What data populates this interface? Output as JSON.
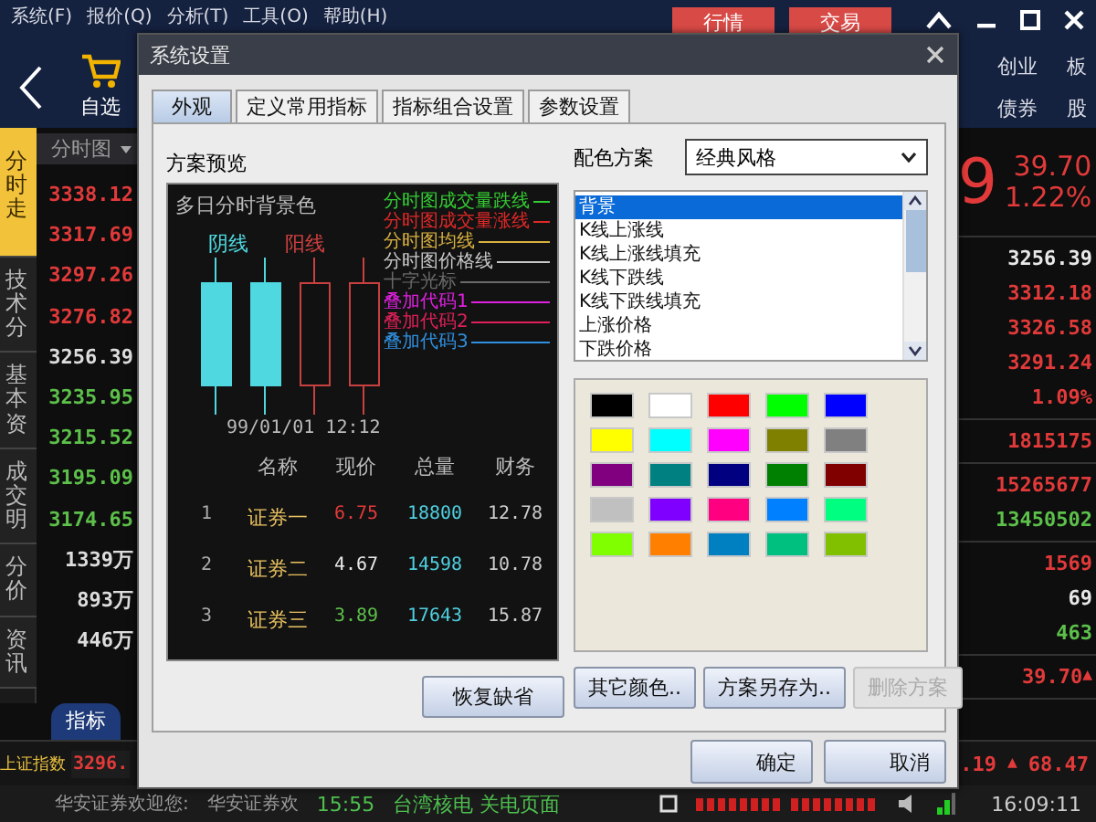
{
  "menu": [
    "系统(F)",
    "报价(Q)",
    "分析(T)",
    "工具(O)",
    "帮助(H)"
  ],
  "top_buttons": [
    "行情",
    "交易"
  ],
  "toolbar": {
    "favorites": "自选",
    "right_items": [
      {
        "top": "创业",
        "bottom": "债券"
      },
      {
        "top": "板",
        "bottom": "股"
      }
    ]
  },
  "side_tabs": [
    {
      "label": "分时走",
      "selected": true
    },
    {
      "label": "技术分",
      "selected": false
    },
    {
      "label": "基本资",
      "selected": false
    },
    {
      "label": "成交明",
      "selected": false
    },
    {
      "label": "分价",
      "selected": false
    },
    {
      "label": "资讯",
      "selected": false
    }
  ],
  "axis": {
    "header": "分时图",
    "values": [
      {
        "text": "3338.12",
        "kind": "up"
      },
      {
        "text": "3317.69",
        "kind": "up"
      },
      {
        "text": "3297.26",
        "kind": "up"
      },
      {
        "text": "3276.82",
        "kind": "up"
      },
      {
        "text": "3256.39",
        "kind": "flat"
      },
      {
        "text": "3235.95",
        "kind": "down"
      },
      {
        "text": "3215.52",
        "kind": "down"
      },
      {
        "text": "3195.09",
        "kind": "down"
      },
      {
        "text": "3174.65",
        "kind": "down"
      },
      {
        "text": "1339万",
        "kind": "flat"
      },
      {
        "text": "893万",
        "kind": "flat"
      },
      {
        "text": "446万",
        "kind": "flat"
      }
    ]
  },
  "right_panel": {
    "big_price": "9",
    "change": "39.70",
    "change_pct": "1.22%",
    "groups": [
      [
        {
          "text": "3256.39",
          "kind": "flat"
        },
        {
          "text": "3312.18",
          "kind": "up"
        },
        {
          "text": "3326.58",
          "kind": "up"
        },
        {
          "text": "3291.24",
          "kind": "up"
        },
        {
          "text": "1.09%",
          "kind": "up"
        }
      ],
      [
        {
          "text": "1815175",
          "kind": "up"
        }
      ],
      [
        {
          "text": "15265677",
          "kind": "up"
        },
        {
          "text": "13450502",
          "kind": "down"
        }
      ],
      [
        {
          "text": "1569",
          "kind": "up"
        },
        {
          "text": "69",
          "kind": "flat"
        },
        {
          "text": "463",
          "kind": "down"
        }
      ],
      [
        {
          "text": "39.70",
          "kind": "up",
          "arrow": "▲"
        }
      ]
    ]
  },
  "bottom_tabs": [
    {
      "label": "指标",
      "selected": true
    }
  ],
  "index_row": {
    "name": "上证指数",
    "value": "3296.",
    "change": ".19",
    "arrow": "▲",
    "amount": "68.47"
  },
  "status_bar": {
    "texts": [
      {
        "text": "华安证券欢迎您:",
        "kind": "info"
      },
      {
        "text": "华安证券欢",
        "kind": "info"
      },
      {
        "text": "15:55",
        "kind": "news"
      },
      {
        "text": "台湾核电 关电页面",
        "kind": "news"
      }
    ],
    "clock": "16:09:11"
  },
  "dialog": {
    "title": "系统设置",
    "tabs": [
      {
        "label": "外观",
        "selected": true
      },
      {
        "label": "定义常用指标",
        "selected": false
      },
      {
        "label": "指标组合设置",
        "selected": false
      },
      {
        "label": "参数设置",
        "selected": false
      }
    ],
    "preview": {
      "label": "方案预览",
      "background_label": "多日分时背景色",
      "legend": [
        {
          "label": "分时图成交量跌线",
          "color": "#33cc33"
        },
        {
          "label": "分时图成交量涨线",
          "color": "#e02828"
        },
        {
          "label": "分时图均线",
          "color": "#d8b040"
        },
        {
          "label": "分时图价格线",
          "color": "#c8c8c8"
        },
        {
          "label": "十字光标",
          "color": "#6a6a6a"
        },
        {
          "label": "叠加代码1",
          "color": "#e020e0"
        },
        {
          "label": "叠加代码2",
          "color": "#e0205a"
        },
        {
          "label": "叠加代码3",
          "color": "#3090e0"
        }
      ],
      "down_label": "阴线",
      "up_label": "阳线",
      "timestamp": "99/01/01 12:12",
      "columns": [
        "名称",
        "现价",
        "总量",
        "财务"
      ],
      "rows": [
        {
          "index": "1",
          "name": "证券一",
          "price": "6.75",
          "kind": "up",
          "volume": "18800",
          "finance": "12.78"
        },
        {
          "index": "2",
          "name": "证券二",
          "price": "4.67",
          "kind": "flat",
          "volume": "14598",
          "finance": "10.78"
        },
        {
          "index": "3",
          "name": "证券三",
          "price": "3.89",
          "kind": "down",
          "volume": "17643",
          "finance": "15.87"
        }
      ]
    },
    "restore_button": "恢复缺省",
    "scheme_label": "配色方案",
    "scheme_value": "经典风格",
    "elements": [
      {
        "label": "背景",
        "selected": true
      },
      {
        "label": "K线上涨线",
        "selected": false
      },
      {
        "label": "K线上涨线填充",
        "selected": false
      },
      {
        "label": "K线下跌线",
        "selected": false
      },
      {
        "label": "K线下跌线填充",
        "selected": false
      },
      {
        "label": "上涨价格",
        "selected": false
      },
      {
        "label": "下跌价格",
        "selected": false
      }
    ],
    "swatches": [
      {
        "color": "#000000"
      },
      {
        "color": "#ffffff"
      },
      {
        "color": "#ff0000"
      },
      {
        "color": "#00ff00"
      },
      {
        "color": "#0000ff"
      },
      {
        "color": "#ffff00"
      },
      {
        "color": "#00ffff"
      },
      {
        "color": "#ff00ff"
      },
      {
        "color": "#808000"
      },
      {
        "color": "#808080"
      },
      {
        "color": "#800080"
      },
      {
        "color": "#008080"
      },
      {
        "color": "#000080"
      },
      {
        "color": "#008000"
      },
      {
        "color": "#800000"
      },
      {
        "color": "#c0c0c0"
      },
      {
        "color": "#8000ff"
      },
      {
        "color": "#ff0080"
      },
      {
        "color": "#0080ff"
      },
      {
        "color": "#00ff80"
      },
      {
        "color": "#80ff00"
      },
      {
        "color": "#ff8000"
      },
      {
        "color": "#0080c0"
      },
      {
        "color": "#00c080"
      },
      {
        "color": "#80c000"
      }
    ],
    "buttons": [
      {
        "label": "其它颜色..",
        "disabled": false
      },
      {
        "label": "方案另存为..",
        "disabled": false
      },
      {
        "label": "删除方案",
        "disabled": true
      }
    ],
    "footer_buttons": [
      "确定",
      "取消"
    ]
  }
}
